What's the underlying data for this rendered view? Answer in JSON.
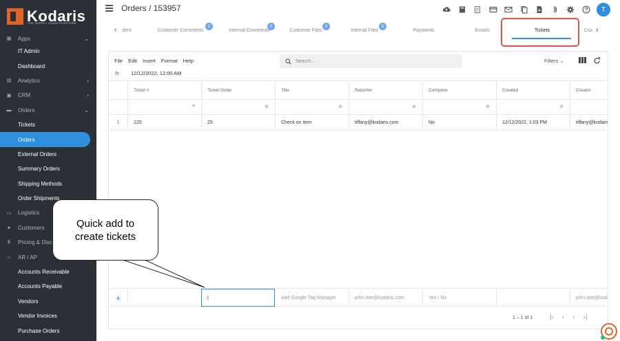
{
  "brand": {
    "name": "Kodaris",
    "tagline": "THE SUPPLY CHAIN PLATFORM"
  },
  "sidebar": {
    "items": [
      {
        "label": "Apps",
        "icon": "apps-icon",
        "kind": "top",
        "chevron": "⌄"
      },
      {
        "label": "IT Admin",
        "kind": "sub"
      },
      {
        "label": "Dashboard",
        "kind": "sub"
      },
      {
        "label": "Analytics",
        "icon": "analytics-icon",
        "kind": "top",
        "chevron": "›"
      },
      {
        "label": "CRM",
        "icon": "crm-icon",
        "kind": "top",
        "chevron": "›"
      },
      {
        "label": "Orders",
        "icon": "cart-icon",
        "kind": "top",
        "chevron": "⌄"
      },
      {
        "label": "Tickets",
        "kind": "sub"
      },
      {
        "label": "Orders",
        "kind": "sub",
        "active": true
      },
      {
        "label": "External Orders",
        "kind": "sub"
      },
      {
        "label": "Summary Orders",
        "kind": "sub"
      },
      {
        "label": "Shipping Methods",
        "kind": "sub"
      },
      {
        "label": "Order Shipments",
        "kind": "sub"
      },
      {
        "label": "Logistics",
        "icon": "truck-icon",
        "kind": "top"
      },
      {
        "label": "Customers",
        "icon": "people-icon",
        "kind": "top"
      },
      {
        "label": "Pricing & Discounts",
        "icon": "dollar-icon",
        "kind": "top"
      },
      {
        "label": "AR / AP",
        "icon": "bank-icon",
        "kind": "top"
      },
      {
        "label": "Accounts Receivable",
        "kind": "sub"
      },
      {
        "label": "Accounts Payable",
        "kind": "sub"
      },
      {
        "label": "Vendors",
        "kind": "sub"
      },
      {
        "label": "Vendor Invoices",
        "kind": "sub"
      },
      {
        "label": "Purchase Orders",
        "kind": "sub"
      }
    ]
  },
  "header": {
    "title": "Orders / 153957",
    "avatar": "T"
  },
  "tabs": {
    "prev": "‹",
    "next": "›",
    "items": [
      {
        "label": "ders"
      },
      {
        "label": "Customer Comments",
        "badge": "0"
      },
      {
        "label": "Internal Comments",
        "badge": "0"
      },
      {
        "label": "Customer Files",
        "badge": "0"
      },
      {
        "label": "Internal Files",
        "badge": "0"
      },
      {
        "label": "Payments"
      },
      {
        "label": "Emails"
      },
      {
        "label": "Tickets",
        "active": true
      },
      {
        "label": "Cus"
      }
    ]
  },
  "toolbar": {
    "menu": [
      "File",
      "Edit",
      "Insert",
      "Format",
      "Help"
    ],
    "search_placeholder": "Search...",
    "filters_label": "Filters"
  },
  "formula": {
    "fx": "fx",
    "value": "12/12/2022, 12:00 AM"
  },
  "grid": {
    "columns": [
      "Ticket #",
      "Ticket Order",
      "Title",
      "Reporter",
      "Complete",
      "Created",
      "Creator"
    ],
    "rows": [
      {
        "num": "1",
        "cells": [
          "120",
          "25",
          "Check on item",
          "tiffany@kodaris.com",
          "No",
          "12/12/2022, 1:03 PM",
          "tiffany@kodaris.com"
        ]
      }
    ],
    "quick_add": {
      "plus": "+",
      "cells": [
        "",
        "|",
        "Add Google Tag Manager",
        "john.doe@kodaris.com",
        "Yes / No",
        "",
        "john.doe@kodaris.com"
      ]
    }
  },
  "pager": {
    "text": "1 – 1 of 1",
    "first": "|‹",
    "prev": "‹",
    "next": "›",
    "last": "›|"
  },
  "callout": {
    "line1": "Quick add to",
    "line2": "create tickets"
  },
  "colors": {
    "accent": "#2f8fdc",
    "sidebar": "#2b3036",
    "brand": "#e0632a",
    "highlight": "#d9554b"
  }
}
